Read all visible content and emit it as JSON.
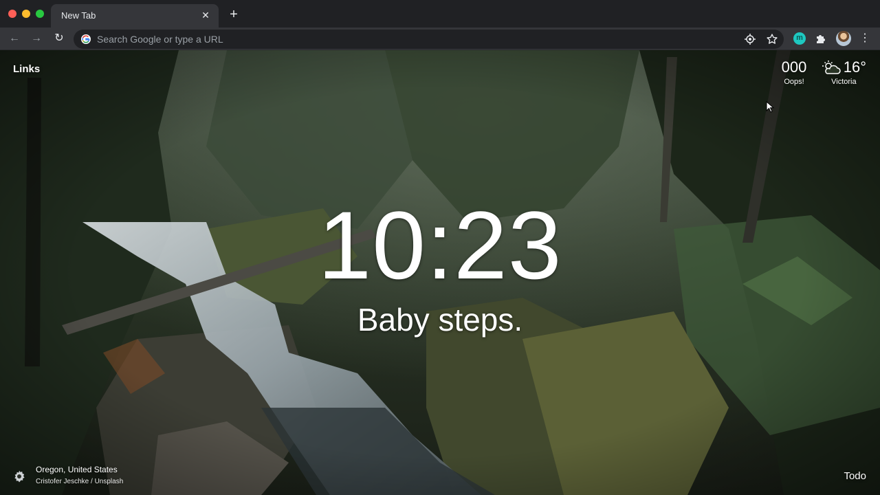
{
  "browser": {
    "tab": {
      "title": "New Tab",
      "close_glyph": "✕"
    },
    "new_tab_glyph": "+",
    "toolbar": {
      "back_glyph": "←",
      "forward_glyph": "→",
      "reload_glyph": "↻",
      "omnibox_placeholder": "Search Google or type a URL",
      "extension_m_label": "m",
      "menu_glyph": "⋮"
    }
  },
  "dashboard": {
    "links_label": "Links",
    "focus": {
      "value": "000",
      "caption": "Oops!"
    },
    "weather": {
      "temperature": "16°",
      "location": "Victoria",
      "icon": "partly-cloudy-icon"
    },
    "clock": "10:23",
    "mantra": "Baby steps.",
    "photo": {
      "location": "Oregon, United States",
      "credit": "Cristofer Jeschke / Unsplash"
    },
    "todo_label": "Todo"
  },
  "colors": {
    "tabstrip": "#202124",
    "toolbar": "#35363a",
    "omnibox": "#202124",
    "text_light": "#e8eaed",
    "text_muted": "#9aa0a6",
    "extension_teal": "#1ec8c0"
  }
}
